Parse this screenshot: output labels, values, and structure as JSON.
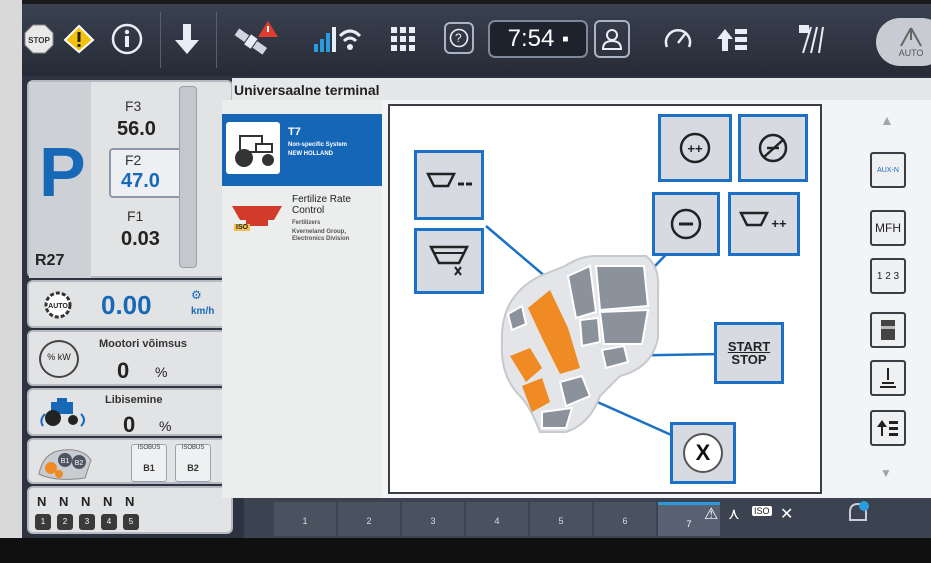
{
  "topbar": {
    "clock": "7:54",
    "help_label": "?",
    "auto_label": "AUTO",
    "stop_label": "STOP"
  },
  "gear_panel": {
    "gear": "P",
    "range": "R27",
    "f3_label": "F3",
    "f3_value": "56.0",
    "f2_label": "F2",
    "f2_value": "47.0",
    "f1_label": "F1",
    "f1_value": "0.03"
  },
  "speed": {
    "value": "0.00",
    "unit": "km/h",
    "auto_label": "AUTO"
  },
  "engine_power": {
    "label": "Mootori võimsus",
    "value": "0",
    "unit": "%",
    "icon_label": "% kW"
  },
  "slip": {
    "label": "Libisemine",
    "value": "0",
    "unit": "%"
  },
  "isobus": {
    "buttons": [
      {
        "title": "ISOBUS",
        "label": "B1"
      },
      {
        "title": "ISOBUS",
        "label": "B2"
      }
    ],
    "map_labels": [
      "B1",
      "B2"
    ]
  },
  "neutral_row": {
    "letters": [
      "N",
      "N",
      "N",
      "N",
      "N"
    ],
    "icons": [
      "1",
      "2",
      "3",
      "4",
      "5"
    ]
  },
  "vt": {
    "header": "Universaalne terminal",
    "items": [
      {
        "title": "T7",
        "line1": "Non-specific System",
        "line2": "NEW HOLLAND"
      },
      {
        "title": "Fertilize Rate Control",
        "line1": "Fertilizers",
        "line2": "Kverneland Group, Electronics Division",
        "badge": "ISO"
      }
    ]
  },
  "canvas": {
    "start_stop": [
      "START",
      "STOP"
    ],
    "close_label": "X",
    "aux_label": "AUX-N",
    "mfh_label": "MFH",
    "counter_label": "1 2 3"
  },
  "tabs": [
    "1",
    "2",
    "3",
    "4",
    "5",
    "6",
    "7"
  ],
  "active_tab": "7",
  "colors": {
    "accent": "#1c71c4",
    "orange": "#f08a22",
    "blue_text": "#1769b8"
  }
}
